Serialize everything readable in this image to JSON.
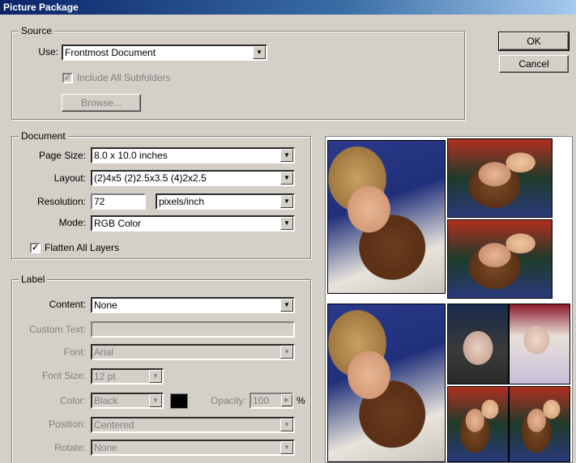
{
  "window": {
    "title": "Picture Package"
  },
  "buttons": {
    "ok": "OK",
    "cancel": "Cancel",
    "browse": "Browse..."
  },
  "source": {
    "legend": "Source",
    "use_label": "Use:",
    "use_value": "Frontmost Document",
    "include_subfolders_label": "Include All Subfolders",
    "include_subfolders_checked": true
  },
  "document": {
    "legend": "Document",
    "page_size_label": "Page Size:",
    "page_size_value": "8.0 x 10.0 inches",
    "layout_label": "Layout:",
    "layout_value": "(2)4x5 (2)2.5x3.5 (4)2x2.5",
    "resolution_label": "Resolution:",
    "resolution_value": "72",
    "resolution_unit": "pixels/inch",
    "mode_label": "Mode:",
    "mode_value": "RGB Color",
    "flatten_label": "Flatten All Layers",
    "flatten_checked": true
  },
  "label": {
    "legend": "Label",
    "content_label": "Content:",
    "content_value": "None",
    "custom_text_label": "Custom Text:",
    "custom_text_value": "",
    "font_label": "Font:",
    "font_value": "Arial",
    "font_size_label": "Font Size:",
    "font_size_value": "12 pt",
    "color_label": "Color:",
    "color_value": "Black",
    "color_swatch": "#000000",
    "opacity_label": "Opacity:",
    "opacity_value": "100",
    "opacity_unit": "%",
    "position_label": "Position:",
    "position_value": "Centered",
    "rotate_label": "Rotate:",
    "rotate_value": "None"
  },
  "icons": {
    "dropdown": "chevron-down-icon",
    "stepper": "chevron-right-icon",
    "check": "checkmark-icon"
  },
  "glyphs": {
    "arrow_down": "▼",
    "arrow_right": "▶",
    "check": "✓"
  }
}
